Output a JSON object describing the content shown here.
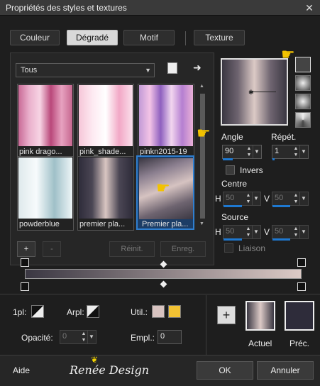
{
  "window": {
    "title": "Propriétés des styles et textures",
    "close_glyph": "✕"
  },
  "tabs": [
    {
      "label": "Couleur"
    },
    {
      "label": "Dégradé"
    },
    {
      "label": "Motif"
    },
    {
      "label": "Texture"
    }
  ],
  "category": {
    "selected": "Tous"
  },
  "gradients": [
    {
      "label": "pink drago..."
    },
    {
      "label": "pink_shade..."
    },
    {
      "label": "pinkn2015-19"
    },
    {
      "label": "powderblue"
    },
    {
      "label": "premier pla..."
    },
    {
      "label": "Premier pla..."
    }
  ],
  "list_buttons": {
    "add": "+",
    "remove": "-",
    "reset": "Réinit.",
    "save": "Enreg."
  },
  "angle": {
    "label": "Angle",
    "value": "90"
  },
  "repeat": {
    "label": "Répét.",
    "value": "1"
  },
  "invert": {
    "label": "Invers"
  },
  "centre": {
    "label": "Centre",
    "h_label": "H",
    "h_value": "50",
    "v_label": "V",
    "v_value": "50"
  },
  "source": {
    "label": "Source",
    "h_label": "H",
    "h_value": "50",
    "v_label": "V",
    "v_value": "50"
  },
  "link": {
    "label": "Liaison"
  },
  "bottom": {
    "pl_label": "1pl:",
    "arpl_label": "Arpl:",
    "util_label": "Util.:",
    "opacity_label": "Opacité:",
    "opacity_value": "0",
    "empl_label": "Empl.:",
    "empl_value": "0",
    "add_glyph": "+",
    "current_label": "Actuel",
    "previous_label": "Préc."
  },
  "footer": {
    "help": "Aide",
    "brand": "Renée Design",
    "ok": "OK",
    "cancel": "Annuler"
  },
  "colors": {
    "accent": "#1e78d0",
    "util_swatch_1": "#d8c3c0",
    "util_swatch_2": "#f2c233",
    "prev_swatch": "#2e2c3a"
  }
}
